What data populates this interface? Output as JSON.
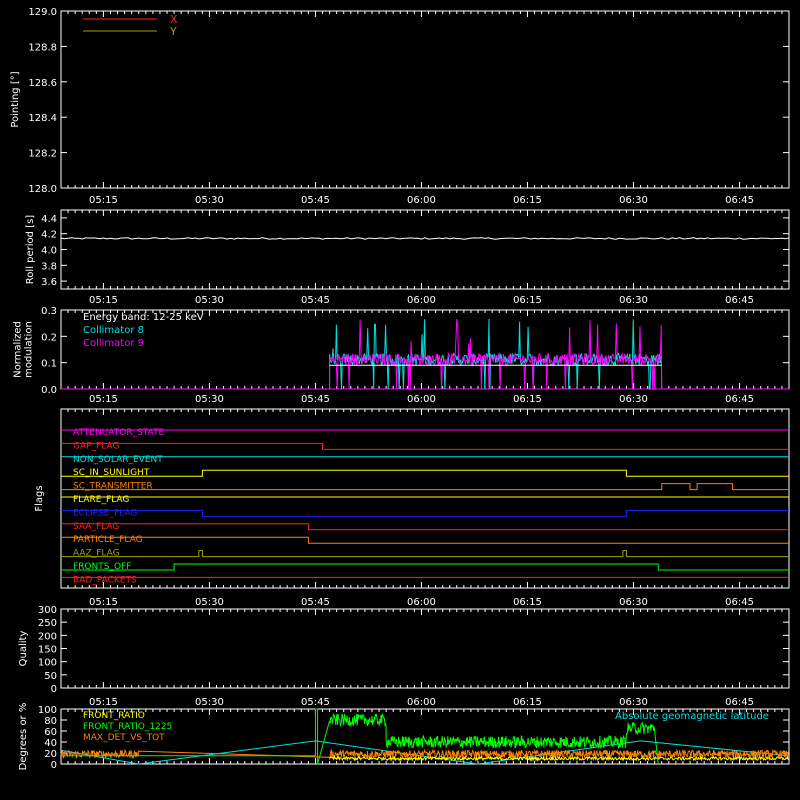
{
  "colors": {
    "background": "#000000",
    "axis": "#ffffff",
    "red": "#ff2020",
    "yellow": "#ffff00",
    "olive": "#a0a000",
    "cyan": "#00e0e0",
    "magenta": "#ff00ff",
    "green": "#00ff00",
    "orange": "#ff8000",
    "blue": "#2020ff",
    "white": "#ffffff"
  },
  "x_ticks": [
    "05:15",
    "05:30",
    "05:45",
    "06:00",
    "06:15",
    "06:30",
    "06:45"
  ],
  "chart_data": [
    {
      "id": "pointing",
      "type": "line",
      "ylabel": "Pointing [°]",
      "ylim": [
        128.0,
        129.0
      ],
      "yticks": [
        "128.0",
        "128.2",
        "128.4",
        "128.6",
        "128.8",
        "129.0"
      ],
      "legend": [
        {
          "name": "X",
          "color": "#ff2020"
        },
        {
          "name": "Y",
          "color": "#a0a000"
        }
      ],
      "series": []
    },
    {
      "id": "roll",
      "type": "line",
      "ylabel": "Roll period [s]",
      "ylim": [
        3.5,
        4.5
      ],
      "yticks": [
        "3.6",
        "3.8",
        "4.0",
        "4.2",
        "4.4"
      ],
      "series": [
        {
          "color": "#ffffff",
          "constant": 4.14
        }
      ]
    },
    {
      "id": "modulation",
      "type": "line",
      "ylabel": [
        "Normalized",
        "modulation"
      ],
      "ylim": [
        0,
        0.3
      ],
      "yticks": [
        "0.0",
        "0.1",
        "0.2",
        "0.3"
      ],
      "annotation": "Energy band: 12-25 keV",
      "legend": [
        {
          "name": "Collimator 8",
          "color": "#00e0e0"
        },
        {
          "name": "Collimator 9",
          "color": "#ff00ff"
        }
      ],
      "active_range": [
        "05:47",
        "06:34"
      ],
      "baseline": 0.09
    },
    {
      "id": "flags",
      "type": "line",
      "ylabel": "Flags",
      "flags": [
        {
          "name": "ATTENUATOR_STATE",
          "color": "#ff00ff",
          "steps": [
            [
              "05:09",
              1
            ],
            [
              "06:52",
              1
            ]
          ]
        },
        {
          "name": "GAP_FLAG",
          "color": "#ff2020",
          "steps": [
            [
              "05:09",
              1
            ],
            [
              "05:46",
              0
            ],
            [
              "06:52",
              0
            ]
          ]
        },
        {
          "name": "NON_SOLAR_EVENT",
          "color": "#00e0e0",
          "steps": [
            [
              "05:09",
              1
            ],
            [
              "06:52",
              1
            ]
          ]
        },
        {
          "name": "SC_IN_SUNLIGHT",
          "color": "#ffff00",
          "steps": [
            [
              "05:09",
              0
            ],
            [
              "05:29",
              1
            ],
            [
              "06:29",
              0
            ],
            [
              "06:52",
              0
            ]
          ]
        },
        {
          "name": "SC_TRANSMITTER",
          "color": "#ff8000",
          "steps": [
            [
              "05:09",
              0
            ],
            [
              "06:34",
              1
            ],
            [
              "06:38",
              0
            ],
            [
              "06:39",
              1
            ],
            [
              "06:44",
              0
            ],
            [
              "06:52",
              0
            ]
          ]
        },
        {
          "name": "FLARE_FLAG",
          "color": "#ffff00",
          "steps": [
            [
              "05:09",
              1
            ],
            [
              "06:52",
              1
            ]
          ]
        },
        {
          "name": "ECLIPSE_FLAG",
          "color": "#2020ff",
          "steps": [
            [
              "05:09",
              1
            ],
            [
              "05:29",
              0
            ],
            [
              "06:29",
              1
            ],
            [
              "06:52",
              1
            ]
          ]
        },
        {
          "name": "SAA_FLAG",
          "color": "#ff2020",
          "steps": [
            [
              "05:09",
              1
            ],
            [
              "05:44",
              0
            ],
            [
              "06:52",
              0
            ]
          ]
        },
        {
          "name": "PARTICLE_FLAG",
          "color": "#ff8000",
          "steps": [
            [
              "05:09",
              1
            ],
            [
              "05:44",
              0
            ],
            [
              "06:52",
              0
            ]
          ]
        },
        {
          "name": "AAZ_FLAG",
          "color": "#a0a000",
          "steps": [
            [
              "05:09",
              0
            ],
            [
              "05:28.5",
              1
            ],
            [
              "05:29",
              0
            ],
            [
              "06:28.5",
              1
            ],
            [
              "06:29",
              0
            ],
            [
              "06:52",
              0
            ]
          ]
        },
        {
          "name": "FRONTS_OFF",
          "color": "#00ff00",
          "steps": [
            [
              "05:09",
              0
            ],
            [
              "05:25",
              1
            ],
            [
              "06:33.5",
              0
            ],
            [
              "06:52",
              0
            ]
          ]
        },
        {
          "name": "BAD_PACKETS",
          "color": "#ff2020",
          "steps": [
            [
              "05:09",
              1
            ],
            [
              "06:52",
              1
            ]
          ]
        }
      ]
    },
    {
      "id": "quality",
      "type": "line",
      "ylabel": "Quality",
      "ylim": [
        0,
        300
      ],
      "yticks": [
        "0",
        "50",
        "100",
        "150",
        "200",
        "250",
        "300"
      ],
      "series": []
    },
    {
      "id": "degrees",
      "type": "line",
      "ylabel": "Degrees or %",
      "ylim": [
        0,
        100
      ],
      "yticks": [
        "0",
        "20",
        "40",
        "60",
        "80",
        "100"
      ],
      "legend_left": [
        {
          "name": "FRONT_RATIO",
          "color": "#ffff00"
        },
        {
          "name": "FRONT_RATIO_1225",
          "color": "#00ff00"
        },
        {
          "name": "MAX_DET_VS_TOT",
          "color": "#ff8000"
        }
      ],
      "legend_right": {
        "name": "Absolute geomagnetic latitude",
        "color": "#00e0e0"
      },
      "geomag_latitude": {
        "x": [
          "05:09",
          "05:20",
          "05:45",
          "06:08",
          "06:31",
          "06:52"
        ],
        "y": [
          25,
          0,
          42,
          0,
          42,
          15
        ]
      },
      "front_ratio_1225": {
        "low": 15,
        "segments": [
          {
            "from": "05:47",
            "to": "05:55",
            "level": 80
          },
          {
            "from": "05:55",
            "to": "06:29",
            "level": 40
          },
          {
            "from": "06:29",
            "to": "06:33",
            "level": 65
          }
        ]
      },
      "max_det_vs_tot": {
        "level": 18
      },
      "front_ratio": {
        "level": 10
      }
    }
  ]
}
